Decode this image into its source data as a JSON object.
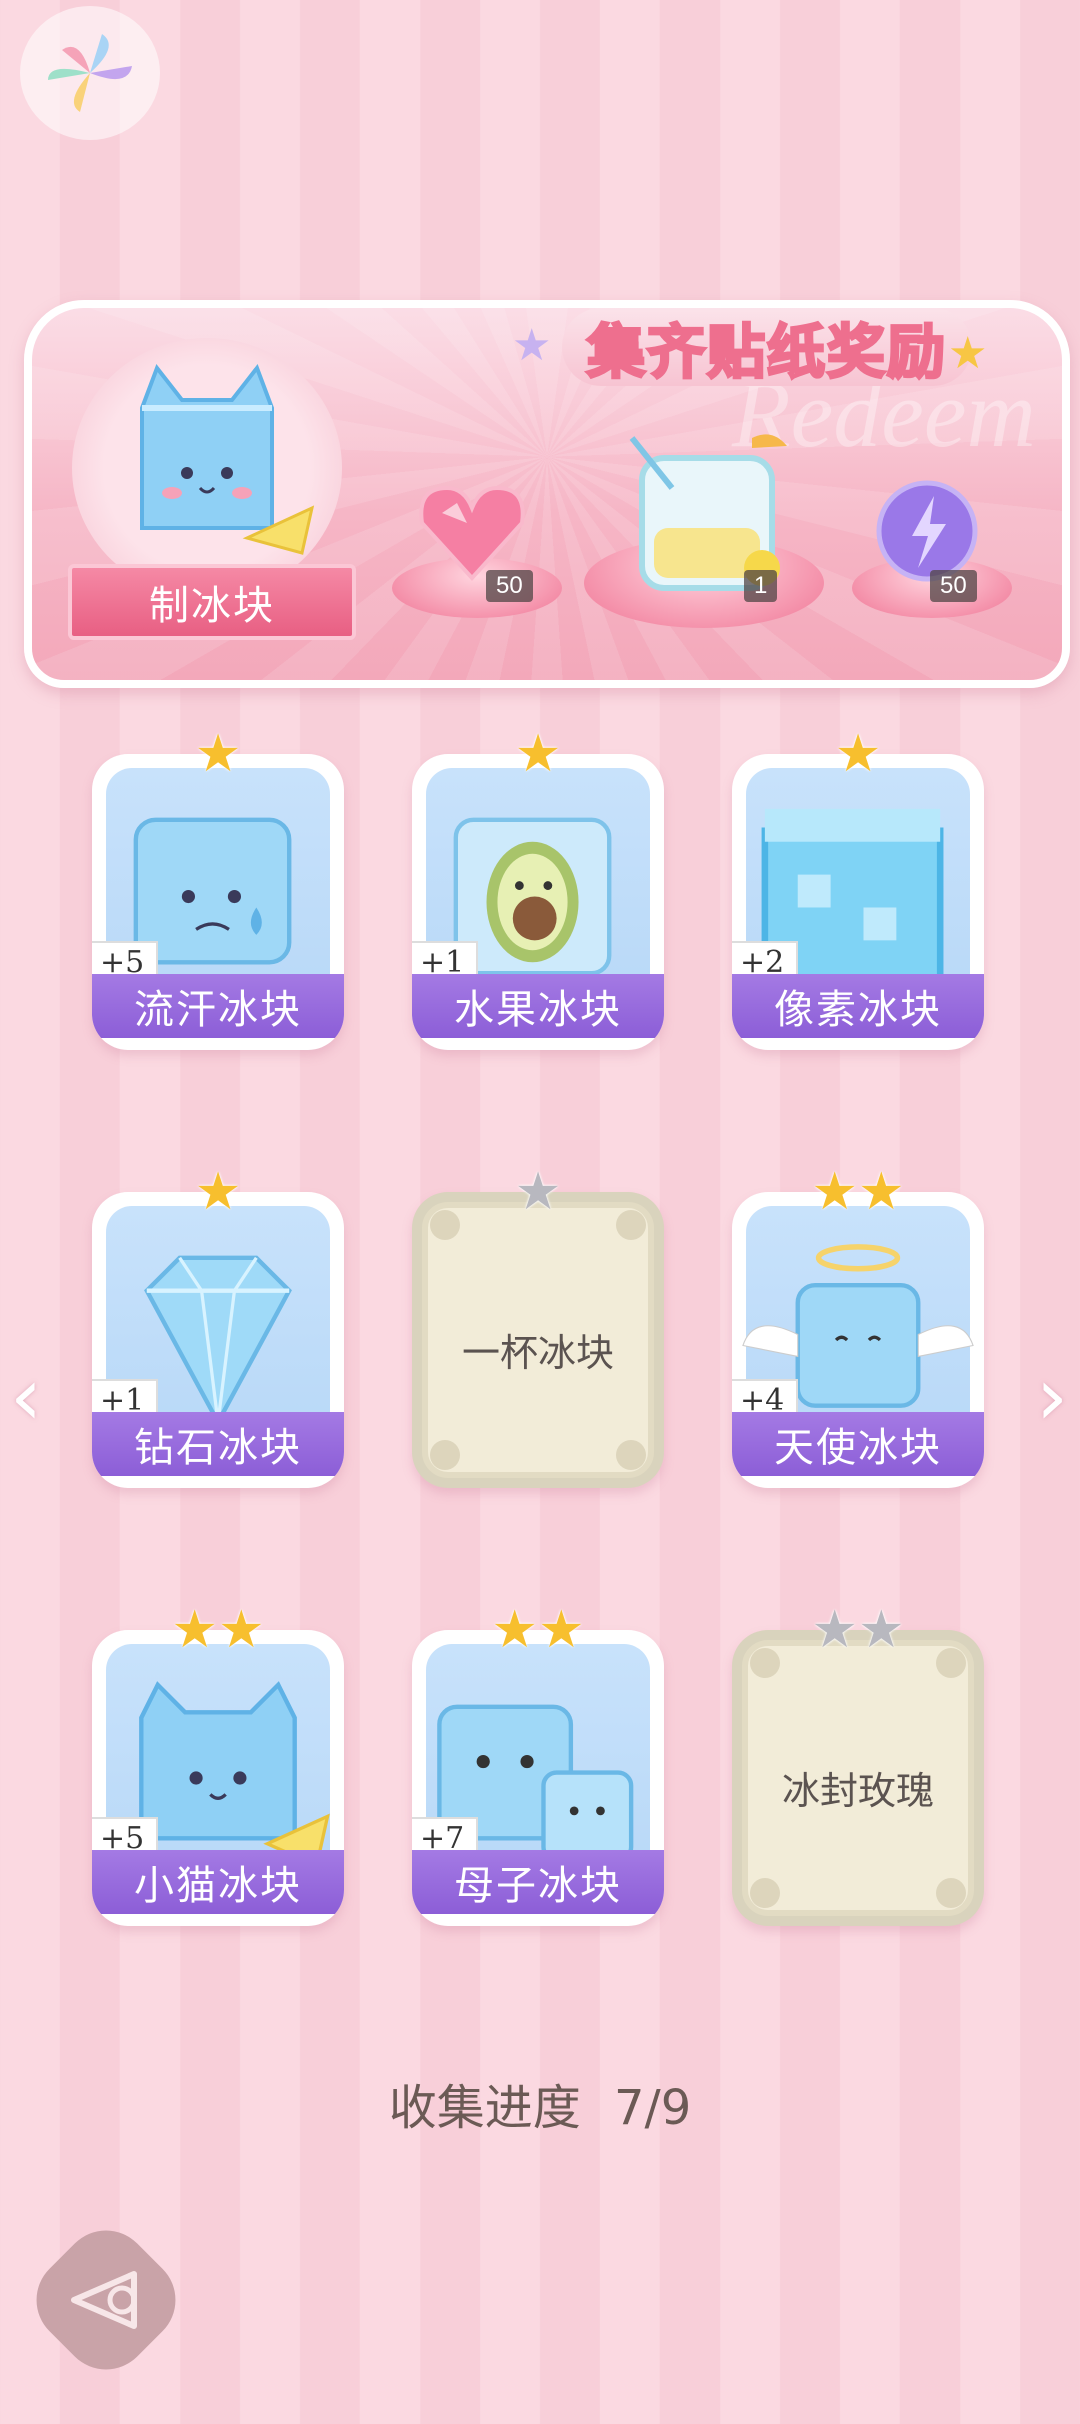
{
  "banner": {
    "title": "集齐贴纸奖励",
    "watermark": "Redeem",
    "make_label": "制冰块",
    "rewards": [
      {
        "icon": "heart-gem-icon",
        "count": "50"
      },
      {
        "icon": "lemonade-cup-icon",
        "count": "1"
      },
      {
        "icon": "lightning-orb-icon",
        "count": "50"
      }
    ]
  },
  "stickers": [
    {
      "name": "流汗冰块",
      "plus": "+5",
      "stars": 1,
      "collected": true,
      "icon": "sweating-ice-cube-icon"
    },
    {
      "name": "水果冰块",
      "plus": "+1",
      "stars": 1,
      "collected": true,
      "icon": "avocado-ice-cube-icon"
    },
    {
      "name": "像素冰块",
      "plus": "+2",
      "stars": 1,
      "collected": true,
      "icon": "pixel-ice-cube-icon"
    },
    {
      "name": "钻石冰块",
      "plus": "+1",
      "stars": 1,
      "collected": true,
      "icon": "diamond-ice-icon"
    },
    {
      "name": "一杯冰块",
      "plus": "",
      "stars": 1,
      "collected": false,
      "icon": "locked-card-icon"
    },
    {
      "name": "天使冰块",
      "plus": "+4",
      "stars": 2,
      "collected": true,
      "icon": "angel-ice-cube-icon"
    },
    {
      "name": "小猫冰块",
      "plus": "+5",
      "stars": 2,
      "collected": true,
      "icon": "cat-ice-cube-icon"
    },
    {
      "name": "母子冰块",
      "plus": "+7",
      "stars": 2,
      "collected": true,
      "icon": "mother-child-ice-cube-icon"
    },
    {
      "name": "冰封玫瑰",
      "plus": "",
      "stars": 2,
      "collected": false,
      "icon": "locked-card-icon"
    }
  ],
  "progress": {
    "label": "收集进度",
    "value": "7/9"
  },
  "nav": {
    "prev": "‹",
    "next": "›"
  },
  "colors": {
    "accent": "#8c5ed7",
    "ribbon": "#e85f83",
    "star": "#f7bf2e"
  }
}
